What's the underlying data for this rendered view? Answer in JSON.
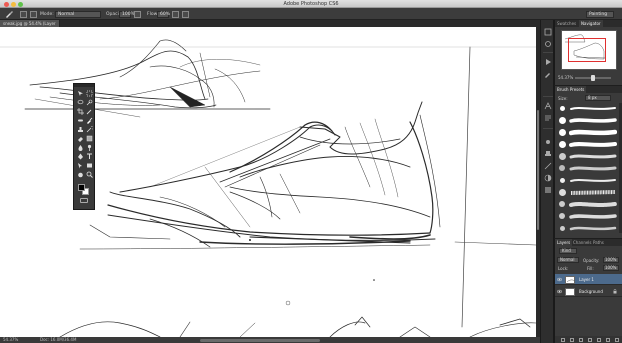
{
  "window": {
    "title": "Adobe Photoshop CS6"
  },
  "options_bar": {
    "mode_label": "Mode:",
    "mode_value": "Normal",
    "opacity_label": "Opacity:",
    "opacity_value": "100%",
    "flow_label": "Flow:",
    "flow_value": "60%",
    "workspace_value": "Painting"
  },
  "document": {
    "tab_title": "sneak.jpg @ 54.4% (Layer 1, RGB/8) *",
    "zoom": "54.37%",
    "doc_size": "Doc: 16.0M/36.4M"
  },
  "navigator": {
    "tabs": [
      "Swatches",
      "Navigator"
    ],
    "active_tab": "Navigator",
    "zoom": "54.37%"
  },
  "brush_presets": {
    "title": "Brush Presets",
    "size_label": "Size:",
    "size_value": "8 px"
  },
  "layers_panel": {
    "tabs": [
      "Layers",
      "Channels",
      "Paths"
    ],
    "active_tab": "Layers",
    "kind_value": "Kind",
    "blend_value": "Normal",
    "opacity_label": "Opacity:",
    "opacity_value": "100%",
    "lock_label": "Lock:",
    "fill_label": "Fill:",
    "fill_value": "100%",
    "layers": [
      {
        "name": "Layer 1",
        "selected": true
      },
      {
        "name": "Background",
        "selected": false
      }
    ]
  },
  "colors": {
    "foreground": "#000000",
    "background": "#ffffff",
    "selection": "#4c6a8c",
    "nav_box": "#e03030"
  }
}
